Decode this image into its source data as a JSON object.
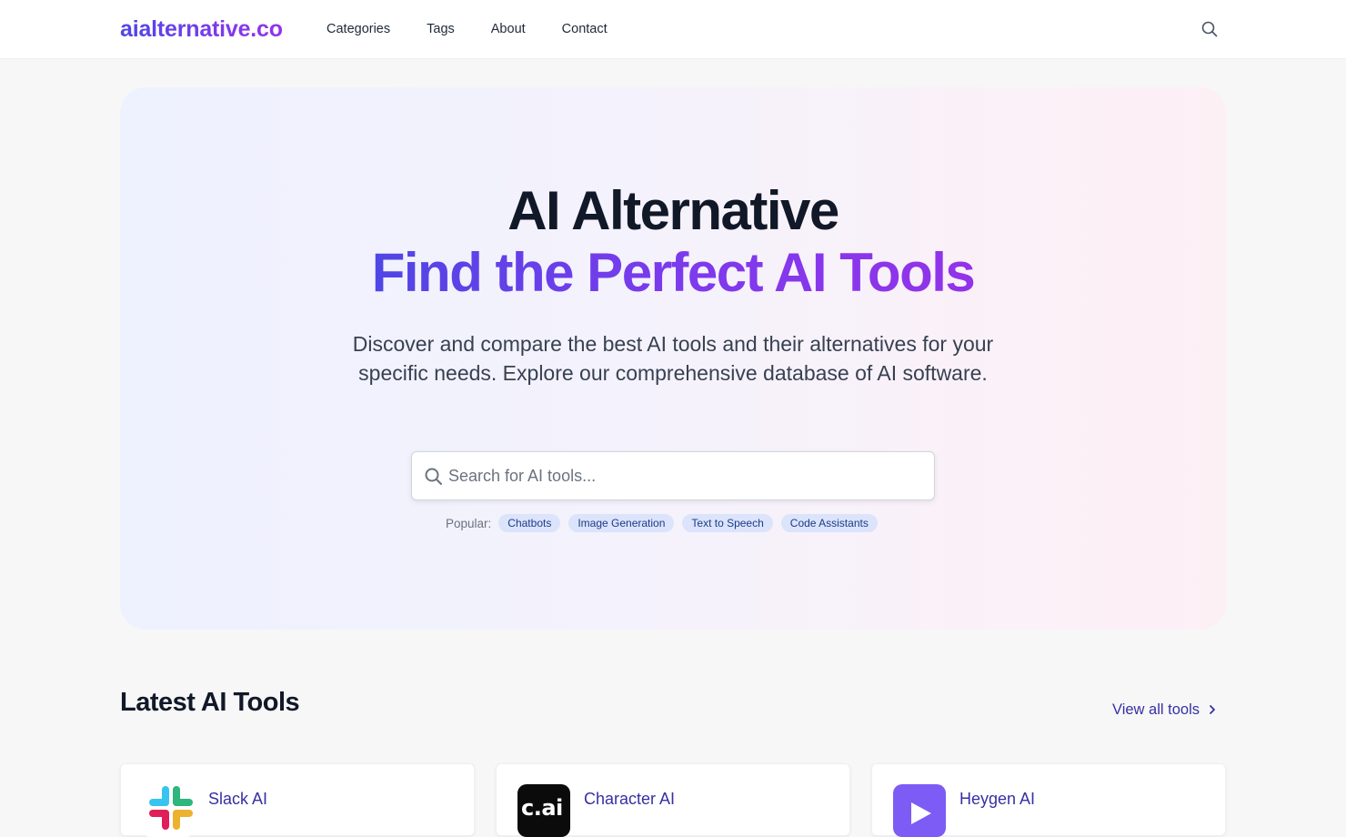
{
  "header": {
    "logo": "aialternative.co",
    "nav": [
      "Categories",
      "Tags",
      "About",
      "Contact"
    ],
    "search_icon": "search-icon"
  },
  "hero": {
    "title": "AI Alternative",
    "subtitle": "Find the Perfect AI Tools",
    "description": "Discover and compare the best AI tools and their alternatives for your specific needs. Explore our comprehensive database of AI software.",
    "search_placeholder": "Search for AI tools...",
    "popular_label": "Popular:",
    "popular_tags": [
      "Chatbots",
      "Image Generation",
      "Text to Speech",
      "Code Assistants"
    ]
  },
  "latest": {
    "title": "Latest AI Tools",
    "view_all": "View all tools",
    "tools": [
      {
        "name": "Slack AI",
        "icon": "slack-logo-icon"
      },
      {
        "name": "Character AI",
        "icon": "character-ai-logo-icon",
        "logo_text": "c.ai"
      },
      {
        "name": "Heygen AI",
        "icon": "heygen-logo-icon"
      }
    ]
  },
  "colors": {
    "brand_start": "#4f46e5",
    "brand_end": "#9333ea",
    "link": "#3730a3",
    "tag_bg": "#dbe4fb"
  }
}
